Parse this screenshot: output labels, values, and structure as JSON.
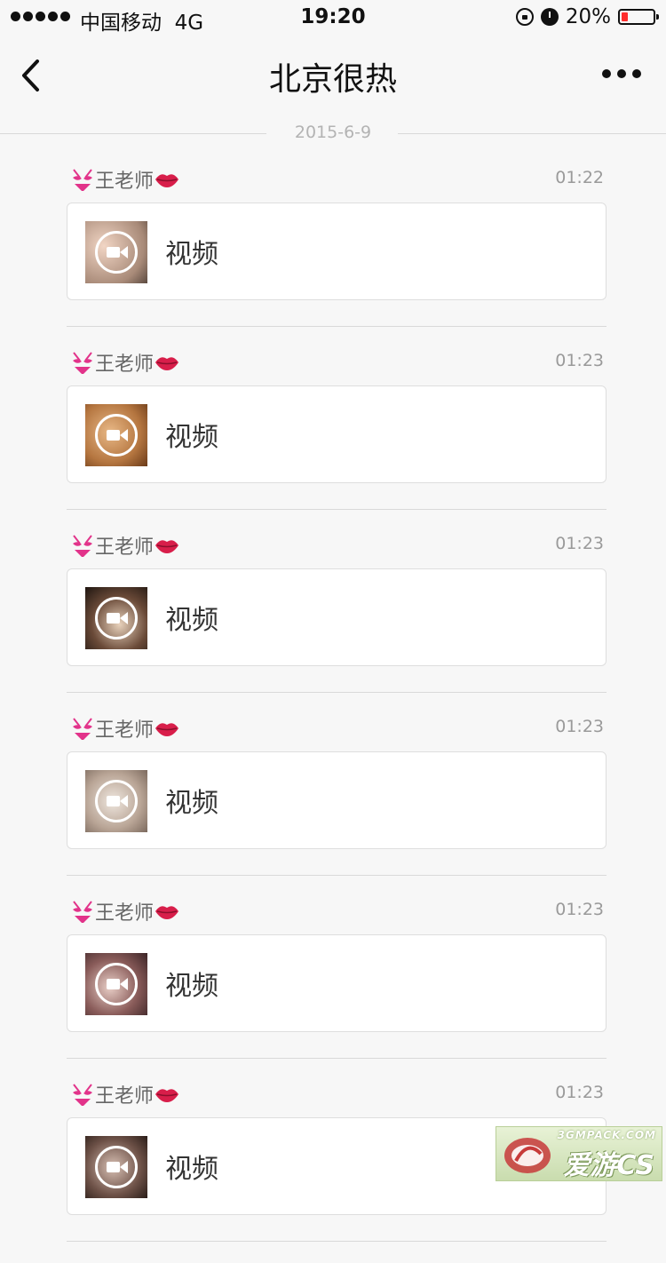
{
  "status_bar": {
    "carrier": "中国移动",
    "network": "4G",
    "time": "19:20",
    "battery_text": "20%",
    "battery_level": 0.2,
    "icons": [
      "signal-dots-icon",
      "rotation-lock-icon",
      "alarm-icon",
      "battery-icon"
    ]
  },
  "nav": {
    "title": "北京很热",
    "back_icon": "chevron-left-icon",
    "more_icon": "more-dots-icon"
  },
  "date_divider": "2015-6-9",
  "messages": [
    {
      "sender": "王老师",
      "time": "01:22",
      "label": "视频"
    },
    {
      "sender": "王老师",
      "time": "01:23",
      "label": "视频"
    },
    {
      "sender": "王老师",
      "time": "01:23",
      "label": "视频"
    },
    {
      "sender": "王老师",
      "time": "01:23",
      "label": "视频"
    },
    {
      "sender": "王老师",
      "time": "01:23",
      "label": "视频"
    },
    {
      "sender": "王老师",
      "time": "01:23",
      "label": "视频"
    }
  ],
  "colors": {
    "background": "#f7f7f7",
    "card": "#ffffff",
    "battery_low": "#ff2d2d",
    "emoji_pink": "#e2338a",
    "lips_red": "#d81e4a"
  },
  "watermark": {
    "url": "3GMPACK.COM",
    "brand": "爱游CS"
  }
}
